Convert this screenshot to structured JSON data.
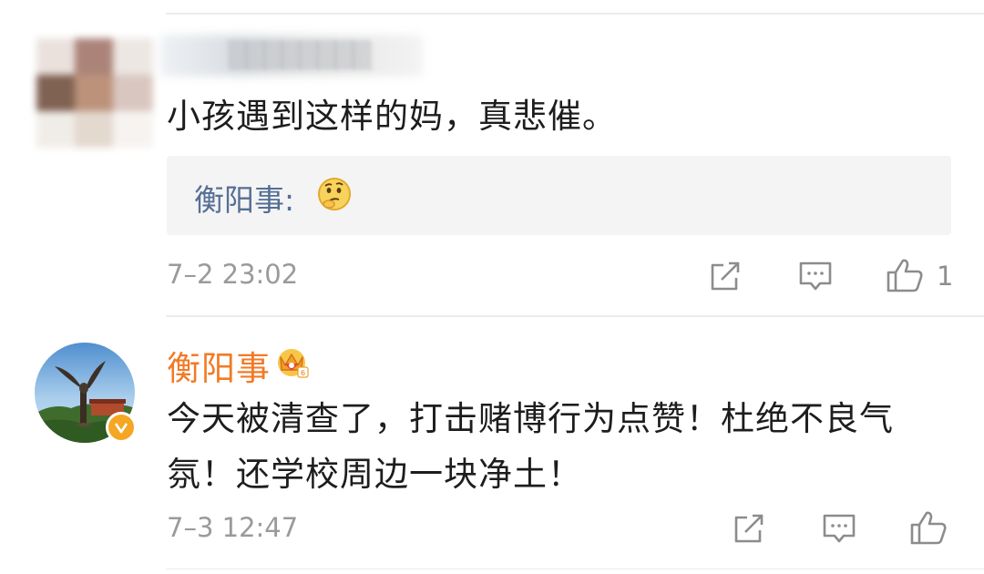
{
  "comments": [
    {
      "text": "小孩遇到这样的妈，真悲催。",
      "reply": {
        "author": "衡阳事:"
      },
      "time": "7–2 23:02",
      "like_count": "1"
    },
    {
      "author": "衡阳事",
      "text_lines": [
        "今天被清查了，打击赌博行为点赞！杜绝不良气",
        "氛！还学校周边一块净土！"
      ],
      "time": "7–3 12:47"
    }
  ],
  "icons": {
    "share": "share-icon",
    "comment": "comment-icon",
    "like": "thumbs-up-icon",
    "emoji": "thinking-face-emoji",
    "crown": "crown-vip-icon",
    "verified": "verified-badge-icon"
  },
  "colors": {
    "username_highlight": "#f27a25",
    "reply_author": "#556f95",
    "timestamp": "#9a9a9a",
    "reply_bg": "#f4f4f4",
    "verified_badge": "#f5a623"
  }
}
